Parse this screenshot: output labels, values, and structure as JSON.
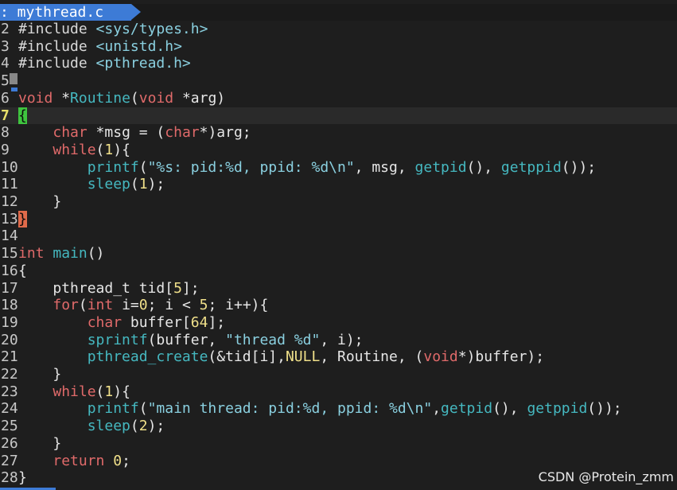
{
  "tab": {
    "label": ": mythread.c"
  },
  "lines": [
    {
      "num": "2",
      "tokens": [
        [
          "#include ",
          "preproc"
        ],
        [
          "<sys/types.h>",
          "inc"
        ]
      ]
    },
    {
      "num": "3",
      "tokens": [
        [
          "#include ",
          "preproc"
        ],
        [
          "<unistd.h>",
          "inc"
        ]
      ]
    },
    {
      "num": "4",
      "tokens": [
        [
          "#include ",
          "preproc"
        ],
        [
          "<pthread.h>",
          "inc"
        ]
      ]
    },
    {
      "num": "5",
      "tokens": []
    },
    {
      "num": "6",
      "tokens": [
        [
          "void",
          "type"
        ],
        [
          " *",
          "plain"
        ],
        [
          "Routine",
          "func"
        ],
        [
          "(",
          "plain"
        ],
        [
          "void",
          "type"
        ],
        [
          " *arg)",
          "plain"
        ]
      ]
    },
    {
      "num": "7",
      "cursor": true,
      "tokens": [
        [
          "{",
          "hlgreen"
        ]
      ]
    },
    {
      "num": "8",
      "tokens": [
        [
          "    ",
          "plain"
        ],
        [
          "char",
          "type"
        ],
        [
          " *msg = (",
          "plain"
        ],
        [
          "char",
          "type"
        ],
        [
          "*)arg;",
          "plain"
        ]
      ]
    },
    {
      "num": "9",
      "tokens": [
        [
          "    ",
          "plain"
        ],
        [
          "while",
          "type"
        ],
        [
          "(",
          "plain"
        ],
        [
          "1",
          "num"
        ],
        [
          "){",
          "plain"
        ]
      ]
    },
    {
      "num": "10",
      "tokens": [
        [
          "        ",
          "plain"
        ],
        [
          "printf",
          "func"
        ],
        [
          "(",
          "plain"
        ],
        [
          "\"%s: pid:%d, ppid: %d\\n\"",
          "str"
        ],
        [
          ", msg, ",
          "plain"
        ],
        [
          "getpid",
          "func"
        ],
        [
          "(), ",
          "plain"
        ],
        [
          "getppid",
          "func"
        ],
        [
          "());",
          "plain"
        ]
      ]
    },
    {
      "num": "11",
      "tokens": [
        [
          "        ",
          "plain"
        ],
        [
          "sleep",
          "func"
        ],
        [
          "(",
          "plain"
        ],
        [
          "1",
          "num"
        ],
        [
          ");",
          "plain"
        ]
      ]
    },
    {
      "num": "12",
      "tokens": [
        [
          "    }",
          "plain"
        ]
      ]
    },
    {
      "num": "13",
      "tokens": [
        [
          "}",
          "hlred"
        ]
      ]
    },
    {
      "num": "14",
      "tokens": []
    },
    {
      "num": "15",
      "tokens": [
        [
          "int",
          "type"
        ],
        [
          " ",
          "plain"
        ],
        [
          "main",
          "func"
        ],
        [
          "()",
          "plain"
        ]
      ]
    },
    {
      "num": "16",
      "tokens": [
        [
          "{",
          "plain"
        ]
      ]
    },
    {
      "num": "17",
      "tokens": [
        [
          "    pthread_t tid[",
          "plain"
        ],
        [
          "5",
          "num"
        ],
        [
          "];",
          "plain"
        ]
      ]
    },
    {
      "num": "18",
      "tokens": [
        [
          "    ",
          "plain"
        ],
        [
          "for",
          "type"
        ],
        [
          "(",
          "plain"
        ],
        [
          "int",
          "type"
        ],
        [
          " i=",
          "plain"
        ],
        [
          "0",
          "num"
        ],
        [
          "; i < ",
          "plain"
        ],
        [
          "5",
          "num"
        ],
        [
          "; i++){",
          "plain"
        ]
      ]
    },
    {
      "num": "19",
      "tokens": [
        [
          "        ",
          "plain"
        ],
        [
          "char",
          "type"
        ],
        [
          " buffer[",
          "plain"
        ],
        [
          "64",
          "num"
        ],
        [
          "];",
          "plain"
        ]
      ]
    },
    {
      "num": "20",
      "tokens": [
        [
          "        ",
          "plain"
        ],
        [
          "sprintf",
          "func"
        ],
        [
          "(buffer, ",
          "plain"
        ],
        [
          "\"thread %d\"",
          "str"
        ],
        [
          ", i);",
          "plain"
        ]
      ]
    },
    {
      "num": "21",
      "tokens": [
        [
          "        ",
          "plain"
        ],
        [
          "pthread_create",
          "func"
        ],
        [
          "(&tid[i],",
          "plain"
        ],
        [
          "NULL",
          "num"
        ],
        [
          ", Routine, (",
          "plain"
        ],
        [
          "void",
          "type"
        ],
        [
          "*)buffer);",
          "plain"
        ]
      ]
    },
    {
      "num": "22",
      "tokens": [
        [
          "    }",
          "plain"
        ]
      ]
    },
    {
      "num": "23",
      "tokens": [
        [
          "    ",
          "plain"
        ],
        [
          "while",
          "type"
        ],
        [
          "(",
          "plain"
        ],
        [
          "1",
          "num"
        ],
        [
          "){",
          "plain"
        ]
      ]
    },
    {
      "num": "24",
      "tokens": [
        [
          "        ",
          "plain"
        ],
        [
          "printf",
          "func"
        ],
        [
          "(",
          "plain"
        ],
        [
          "\"main thread: pid:%d, ppid: %d\\n\"",
          "str"
        ],
        [
          ",",
          "plain"
        ],
        [
          "getpid",
          "func"
        ],
        [
          "(), ",
          "plain"
        ],
        [
          "getppid",
          "func"
        ],
        [
          "());",
          "plain"
        ]
      ]
    },
    {
      "num": "25",
      "tokens": [
        [
          "        ",
          "plain"
        ],
        [
          "sleep",
          "func"
        ],
        [
          "(",
          "plain"
        ],
        [
          "2",
          "num"
        ],
        [
          ");",
          "plain"
        ]
      ]
    },
    {
      "num": "26",
      "tokens": [
        [
          "    }",
          "plain"
        ]
      ]
    },
    {
      "num": "27",
      "tokens": [
        [
          "    ",
          "plain"
        ],
        [
          "return",
          "type"
        ],
        [
          " ",
          "plain"
        ],
        [
          "0",
          "num"
        ],
        [
          ";",
          "plain"
        ]
      ]
    },
    {
      "num": "28",
      "tokens": [
        [
          "}",
          "plain"
        ]
      ]
    }
  ],
  "watermark": "CSDN @Protein_zmm"
}
